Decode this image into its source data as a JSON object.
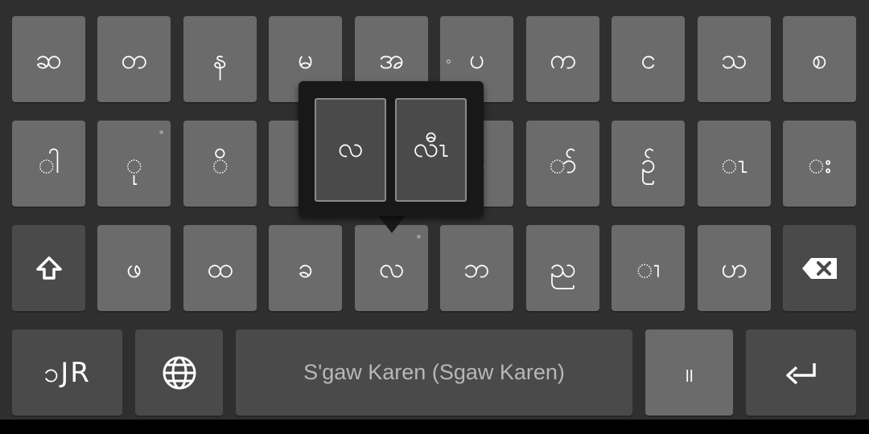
{
  "keyboard": {
    "row1": [
      "ဆ",
      "တ",
      "န",
      "မ",
      "အ",
      "ပ",
      "က",
      "င",
      "သ",
      "စ"
    ],
    "row2": [
      "ါ",
      "ု",
      "ိ",
      "ဲ",
      "ွ",
      "ံ",
      "ာ်",
      "ဉ်",
      "ၤ",
      "း"
    ],
    "row3": [
      "ဖ",
      "ထ",
      "ခ",
      "လ",
      "ဘ",
      "ည",
      "ၢ",
      "ဟ"
    ],
    "bottom": {
      "lang_key_label": "ၥJR",
      "space_label": "S'gaw Karen (Sgaw Karen)",
      "punct_label": "။"
    }
  },
  "popup": {
    "options": [
      "လ",
      "လီၤ"
    ]
  },
  "colors": {
    "background": "#2f2f2f",
    "key": "#6b6b6b",
    "key_dark": "#4a4a4a",
    "popup": "#181818"
  }
}
